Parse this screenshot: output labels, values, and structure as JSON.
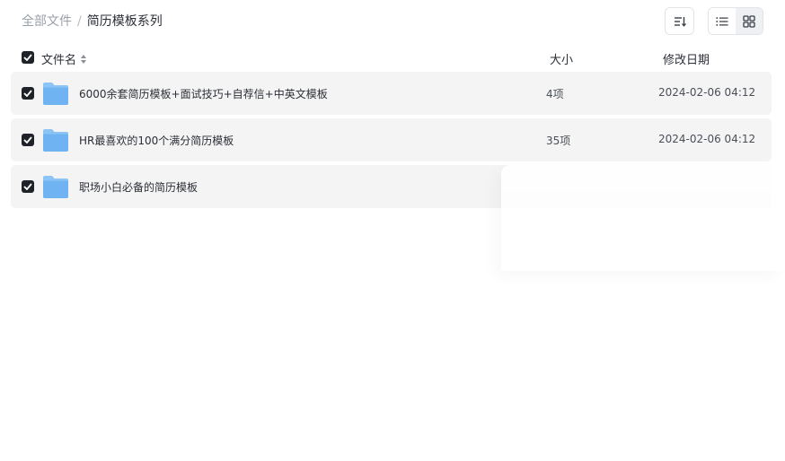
{
  "breadcrumb": {
    "root": "全部文件",
    "separator": "/",
    "current": "简历模板系列"
  },
  "toolbar": {
    "sort_icon": "sort-icon",
    "list_view_icon": "list-view-icon",
    "grid_view_icon": "grid-view-icon"
  },
  "columns": {
    "name": "文件名",
    "size": "大小",
    "date": "修改日期"
  },
  "rows": [
    {
      "name": "6000余套简历模板+面试技巧+自荐信+中英文模板",
      "size": "4项",
      "date": "2024-02-06 04:12",
      "icon": "folder-icon",
      "checked": true
    },
    {
      "name": "HR最喜欢的100个满分简历模板",
      "size": "35项",
      "date": "2024-02-06 04:12",
      "icon": "folder-icon",
      "checked": true
    },
    {
      "name": "职场小白必备的简历模板",
      "size": "",
      "date": "",
      "icon": "folder-icon",
      "checked": true
    }
  ],
  "colors": {
    "row_bg": "#f4f4f5",
    "checkbox": "#1f2329",
    "folder_blue": "#6fb3f2"
  }
}
